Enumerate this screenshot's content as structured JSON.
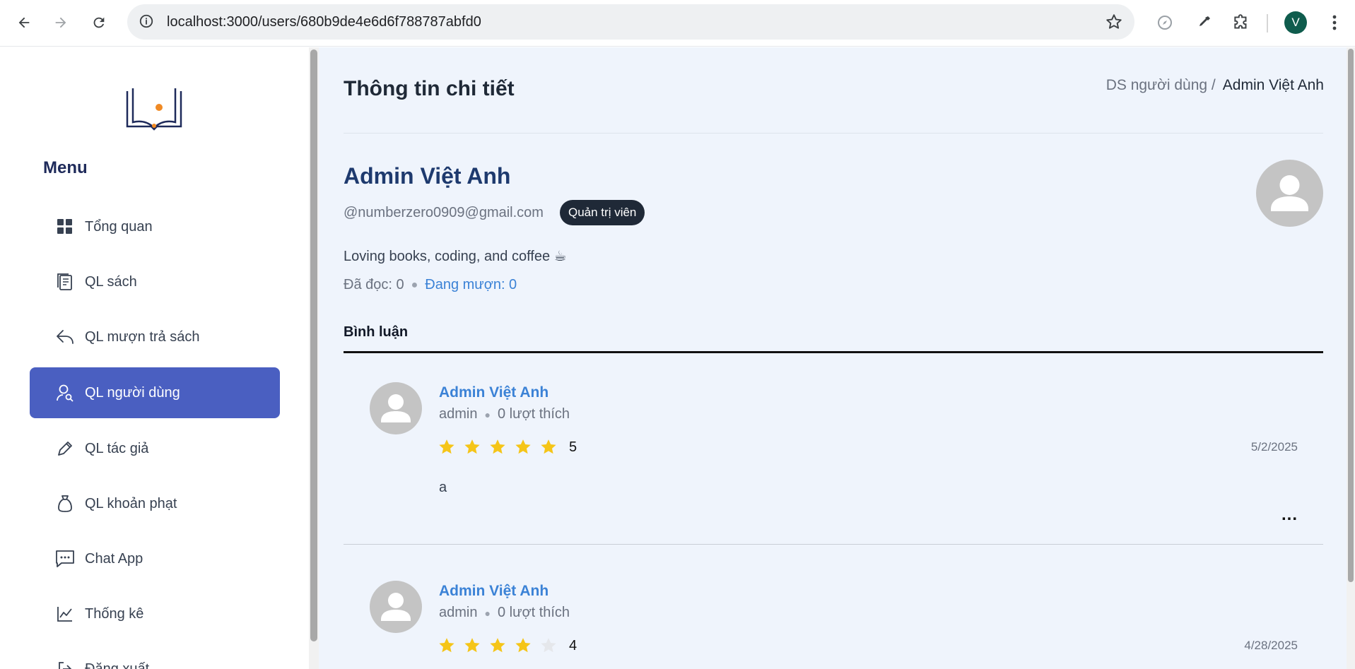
{
  "browser": {
    "url": "localhost:3000/users/680b9de4e6d6f788787abfd0",
    "profile_initial": "V"
  },
  "sidebar": {
    "menu_title": "Menu",
    "items": [
      {
        "label": "Tổng quan",
        "icon": "grid-icon"
      },
      {
        "label": "QL sách",
        "icon": "books-icon"
      },
      {
        "label": "QL mượn trả sách",
        "icon": "reply-icon"
      },
      {
        "label": "QL người dùng",
        "icon": "user-search-icon",
        "active": true
      },
      {
        "label": "QL tác giả",
        "icon": "pen-icon"
      },
      {
        "label": "QL khoản phạt",
        "icon": "money-bag-icon"
      },
      {
        "label": "Chat App",
        "icon": "chat-icon"
      },
      {
        "label": "Thống kê",
        "icon": "line-chart-icon"
      },
      {
        "label": "Đăng xuất",
        "icon": "logout-icon"
      }
    ]
  },
  "header": {
    "title": "Thông tin chi tiết",
    "breadcrumb_parent": "DS người dùng /",
    "breadcrumb_current": "Admin Việt Anh"
  },
  "profile": {
    "name": "Admin Việt Anh",
    "email": "@numberzero0909@gmail.com",
    "role": "Quản trị viên",
    "bio": "Loving books, coding, and coffee ☕",
    "read_count": "Đã đọc: 0",
    "borrowing_count": "Đang mượn: 0"
  },
  "tabs": {
    "comments": "Bình luận"
  },
  "comments": [
    {
      "author": "Admin Việt Anh",
      "role": "admin",
      "likes": "0 lượt thích",
      "rating": 5,
      "rating_label": "5",
      "date": "5/2/2025",
      "text": "a",
      "more": "..."
    },
    {
      "author": "Admin Việt Anh",
      "role": "admin",
      "likes": "0 lượt thích",
      "rating": 4,
      "rating_label": "4",
      "date": "4/28/2025",
      "text": "",
      "more": "..."
    }
  ],
  "colors": {
    "accent": "#4a5fc1",
    "link": "#3b82d6",
    "star_filled": "#f5c518",
    "star_empty": "#e5e7eb",
    "main_bg": "#eff4fc"
  }
}
